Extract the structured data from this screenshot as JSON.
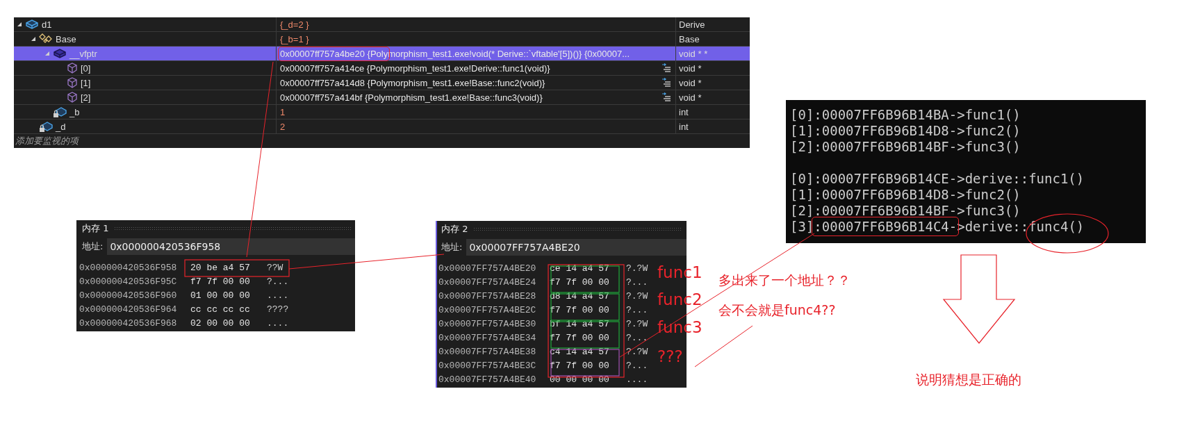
{
  "watch_window": {
    "rows": [
      {
        "name": "d1",
        "value": "{_d=2 }",
        "type": "Derive",
        "kind": "object",
        "changed": true,
        "selected": false,
        "expanded": true,
        "children": [
          {
            "name": "Base",
            "value": "{_b=1 }",
            "type": "Base",
            "kind": "base",
            "changed": true,
            "selected": false,
            "expanded": true,
            "children": [
              {
                "name": "__vfptr",
                "value": [
                  {
                    "text": "0x00007ff757a4be20 {Poly",
                    "framed": true
                  },
                  {
                    "text": "morphism_test1.exe!void(* Derive::`vftable'[5])()} {0x00007...",
                    "framed": false
                  }
                ],
                "type": "void * *",
                "kind": "pointer",
                "changed": false,
                "selected": true,
                "expanded": true,
                "children": [
                  {
                    "name": "[0]",
                    "value": "0x00007ff757a414ce {Polymorphism_test1.exe!Derive::func1(void)}",
                    "type": "void *",
                    "kind": "element",
                    "changed": false,
                    "selected": false
                  },
                  {
                    "name": "[1]",
                    "value": "0x00007ff757a414d8 {Polymorphism_test1.exe!Base::func2(void)}",
                    "type": "void *",
                    "kind": "element",
                    "changed": false,
                    "selected": false
                  },
                  {
                    "name": "[2]",
                    "value": "0x00007ff757a414bf {Polymorphism_test1.exe!Base::func3(void)}",
                    "type": "void *",
                    "kind": "element",
                    "changed": false,
                    "selected": false
                  }
                ]
              },
              {
                "name": "_b",
                "value": "1",
                "type": "int",
                "kind": "member",
                "changed": true,
                "selected": false
              }
            ]
          },
          {
            "name": "_d",
            "value": "2",
            "type": "int",
            "kind": "member",
            "changed": true,
            "selected": false
          }
        ]
      }
    ],
    "add_item_placeholder": "添加要监视的项"
  },
  "memory_windows": [
    {
      "title": "内存 1",
      "address_label": "地址:",
      "address": "0x000000420536F958",
      "active": false,
      "rows": [
        [
          "0x000000420536F958",
          "20 be a4 57",
          "??W"
        ],
        [
          "0x000000420536F95C",
          "f7 7f 00 00",
          "?..."
        ],
        [
          "0x000000420536F960",
          "01 00 00 00",
          "...."
        ],
        [
          "0x000000420536F964",
          "cc cc cc cc",
          "????"
        ],
        [
          "0x000000420536F968",
          "02 00 00 00",
          "...."
        ]
      ]
    },
    {
      "title": "内存 2",
      "address_label": "地址:",
      "address": "0x00007FF757A4BE20",
      "active": true,
      "rows": [
        [
          "0x00007FF757A4BE20",
          "ce 14 a4 57",
          "?.?W"
        ],
        [
          "0x00007FF757A4BE24",
          "f7 7f 00 00",
          "?..."
        ],
        [
          "0x00007FF757A4BE28",
          "d8 14 a4 57",
          "?.?W"
        ],
        [
          "0x00007FF757A4BE2C",
          "f7 7f 00 00",
          "?..."
        ],
        [
          "0x00007FF757A4BE30",
          "bf 14 a4 57",
          "?.?W"
        ],
        [
          "0x00007FF757A4BE34",
          "f7 7f 00 00",
          "?..."
        ],
        [
          "0x00007FF757A4BE38",
          "c4 14 a4 57",
          "?.?W"
        ],
        [
          "0x00007FF757A4BE3C",
          "f7 7f 00 00",
          "?..."
        ],
        [
          "0x00007FF757A4BE40",
          "00 00 00 00",
          "...."
        ]
      ]
    }
  ],
  "console": {
    "groups": [
      [
        "[0]:00007FF6B96B14BA->func1()",
        "[1]:00007FF6B96B14D8->func2()",
        "[2]:00007FF6B96B14BF->func3()"
      ],
      [
        "[0]:00007FF6B96B14CE->derive::func1()",
        "[1]:00007FF6B96B14D8->func2()",
        "[2]:00007FF6B96B14BF->func3()",
        [
          {
            "text": "[3]",
            "framed": false
          },
          {
            "text": ":00007FF6B96B14C4-",
            "framed": true
          },
          {
            "text": ">derive::func4()",
            "framed": false
          }
        ]
      ]
    ]
  },
  "annotations": [
    {
      "text": "func1",
      "kind": "label"
    },
    {
      "text": "func2",
      "kind": "label"
    },
    {
      "text": "func3",
      "kind": "label"
    },
    {
      "text": "???",
      "kind": "label"
    },
    {
      "text": "多出来了一个地址？？",
      "kind": "note"
    },
    {
      "text": "会不会就是func4??",
      "kind": "note"
    },
    {
      "text": "说明猜想是正确的",
      "kind": "note"
    }
  ]
}
